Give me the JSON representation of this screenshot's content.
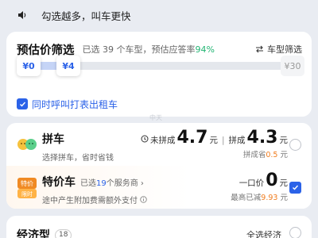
{
  "tip": {
    "text": "勾选越多，叫车更快",
    "icon": "speaker-icon"
  },
  "price_filter": {
    "title": "预估价筛选",
    "selected_prefix": "已选",
    "selected_count": "39",
    "selected_suffix": "个车型，预估应答率",
    "answer_rate": "94%",
    "filter_link": "车型筛选",
    "slider": {
      "min_label": "¥0",
      "max_label": "¥4",
      "end_label": "¥30",
      "fill_fraction": 0.21
    },
    "taxi_checkbox_label": "同时呼叫打表出租车",
    "taxi_checked": true
  },
  "watermark": "中天",
  "cars": [
    {
      "name": "拼车",
      "desc": "选择拼车，省时省钱",
      "price1_label": "未拼成",
      "price1_value": "4.7",
      "price1_unit": "元",
      "price2_label": "拼成",
      "price2_value": "4.3",
      "price2_unit": "元",
      "save_text": "拼成省",
      "save_value": "0.5",
      "save_unit": "元",
      "selected": false
    },
    {
      "name": "特价车",
      "badge_top": "特价",
      "badge_bottom": "限时",
      "svc_prefix": "已选",
      "svc_count": "19",
      "svc_suffix": "个服务商",
      "desc": "途中产生附加费需额外支付",
      "price_label": "一口价",
      "price_value": "0",
      "price_unit": "元",
      "save_text": "最高已减",
      "save_value": "9.93",
      "save_unit": "元",
      "selected": true
    }
  ],
  "economy": {
    "title": "经济型",
    "count": "18",
    "select_all": "全选经济"
  },
  "colors": {
    "accent": "#2b62e8",
    "green": "#22b573",
    "orange": "#f07c1e"
  }
}
